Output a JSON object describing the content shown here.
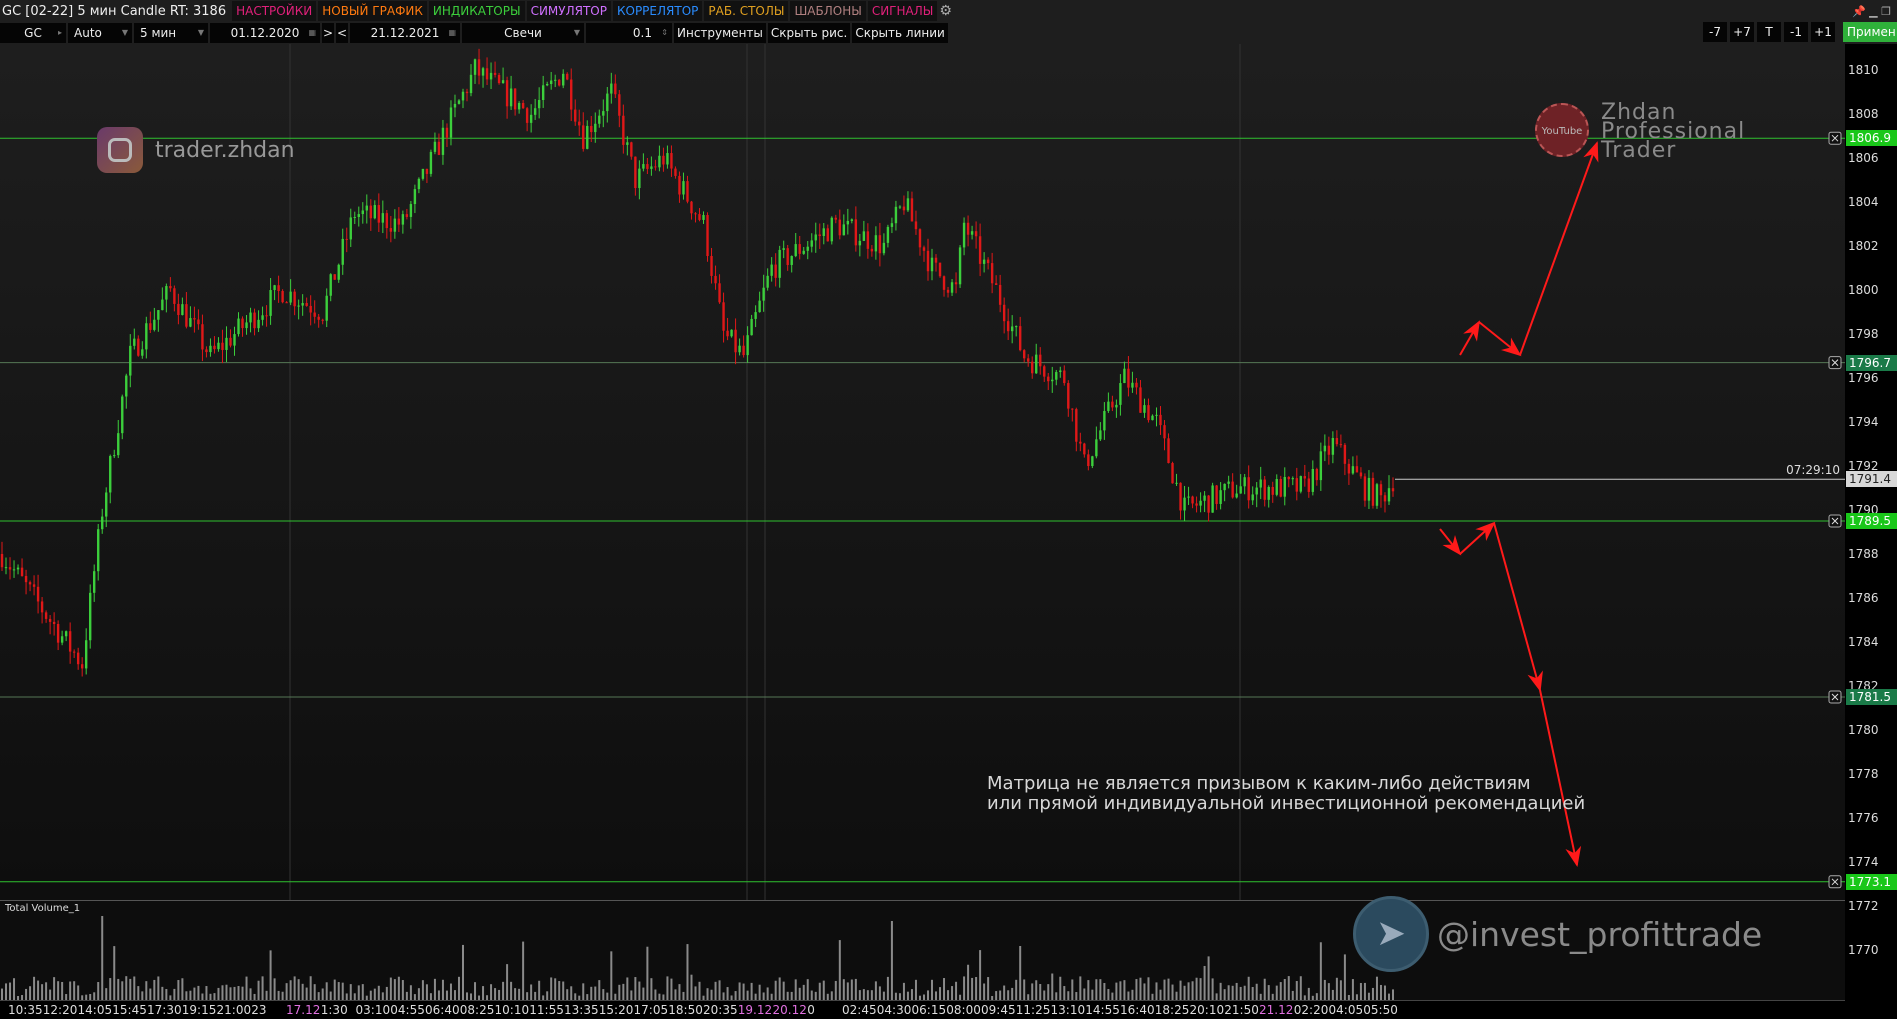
{
  "header": {
    "title": "GC [02-22] 5 мин Candle RT: 3186",
    "menu": [
      {
        "label": "НАСТРОЙКИ",
        "color": "#e0207a"
      },
      {
        "label": "НОВЫЙ ГРАФИК",
        "color": "#ff7a10"
      },
      {
        "label": "ИНДИКАТОРЫ",
        "color": "#3ccf3c"
      },
      {
        "label": "СИМУЛЯТОР",
        "color": "#d070ff"
      },
      {
        "label": "КОРРЕЛЯТОР",
        "color": "#2a8cff"
      },
      {
        "label": "РАБ. СТОЛЫ",
        "color": "#e0a020"
      },
      {
        "label": "ШАБЛОНЫ",
        "color": "#b08080"
      },
      {
        "label": "СИГНАЛЫ",
        "color": "#e0207a"
      }
    ]
  },
  "toolbar": {
    "symbol": "GC",
    "scale": "Auto",
    "timeframe": "5 мин",
    "date_from": "01.12.2020",
    "next": ">",
    "prev": "<",
    "date_to": "21.12.2021",
    "chart_type": "Свечи",
    "step": "0.1",
    "instruments": "Инструменты",
    "hide_drawings": "Скрыть рис.",
    "hide_lines": "Скрыть линии",
    "nav": [
      "-7",
      "+7",
      "T",
      "-1",
      "+1"
    ],
    "apply": "Примен"
  },
  "price_axis": {
    "ticks": [
      1810,
      1808,
      1806,
      1804,
      1802,
      1800,
      1798,
      1796,
      1794,
      1792,
      1790,
      1788,
      1786,
      1784,
      1782,
      1780,
      1778,
      1776,
      1774,
      1772,
      1770
    ]
  },
  "levels": [
    {
      "price": "1806.9",
      "color": "#19c719"
    },
    {
      "price": "1796.7",
      "color": "#1a7a48"
    },
    {
      "price": "1789.5",
      "color": "#19c719"
    },
    {
      "price": "1781.5",
      "color": "#1a7a48"
    },
    {
      "price": "1773.1",
      "color": "#19c719"
    }
  ],
  "current": {
    "price": "1791.4",
    "timer": "07:29:10"
  },
  "volume_label": "Total Volume_1",
  "time_axis": [
    {
      "t": "10:35"
    },
    {
      "t": "12:20"
    },
    {
      "t": "14:05"
    },
    {
      "t": "15:45"
    },
    {
      "t": "17:30"
    },
    {
      "t": "19:15"
    },
    {
      "t": "21:00"
    },
    {
      "t": "23"
    },
    {
      "t": "17.12",
      "d": 1
    },
    {
      "t": "1:30"
    },
    {
      "t": "03:10"
    },
    {
      "t": "04:55"
    },
    {
      "t": "06:40"
    },
    {
      "t": "08:25"
    },
    {
      "t": "10:10"
    },
    {
      "t": "11:55"
    },
    {
      "t": "13:35"
    },
    {
      "t": "15:20"
    },
    {
      "t": "17:05"
    },
    {
      "t": "18:50"
    },
    {
      "t": "20:35"
    },
    {
      "t": "19.12",
      "d": 1
    },
    {
      "t": "20.12",
      "d": 1
    },
    {
      "t": "0"
    },
    {
      "t": "02:45"
    },
    {
      "t": "04:30"
    },
    {
      "t": "06:15"
    },
    {
      "t": "08:00"
    },
    {
      "t": "09:45"
    },
    {
      "t": "11:25"
    },
    {
      "t": "13:10"
    },
    {
      "t": "14:55"
    },
    {
      "t": "16:40"
    },
    {
      "t": "18:25"
    },
    {
      "t": "20:10"
    },
    {
      "t": "21:50"
    },
    {
      "t": "21.12",
      "d": 1
    },
    {
      "t": "02:20"
    },
    {
      "t": "04:05"
    },
    {
      "t": "05:50"
    }
  ],
  "watermarks": {
    "instagram": "trader.zhdan",
    "youtube": [
      "Zhdan",
      "Professional",
      "Trader"
    ],
    "youtube_logo": "YouTube",
    "telegram": "@invest_profittrade"
  },
  "disclaimer": [
    "Матрица не является призывом к каким-либо действиям",
    "или прямой индивидуальной инвестиционной рекомендацией"
  ],
  "chart_data": {
    "type": "candlestick",
    "ylim": [
      1768.5,
      1811
    ],
    "bars": 348,
    "path": [
      [
        0,
        1788
      ],
      [
        20,
        1783
      ],
      [
        25,
        1790
      ],
      [
        32,
        1797
      ],
      [
        42,
        1800
      ],
      [
        52,
        1797
      ],
      [
        70,
        1800
      ],
      [
        80,
        1799
      ],
      [
        88,
        1803.5
      ],
      [
        100,
        1803
      ],
      [
        110,
        1807
      ],
      [
        118,
        1810
      ],
      [
        132,
        1808
      ],
      [
        140,
        1810
      ],
      [
        145,
        1807
      ],
      [
        152,
        1809
      ],
      [
        158,
        1805
      ],
      [
        165,
        1806
      ],
      [
        175,
        1803
      ],
      [
        180,
        1798
      ],
      [
        185,
        1797
      ],
      [
        192,
        1801
      ],
      [
        208,
        1803
      ],
      [
        220,
        1802
      ],
      [
        225,
        1804
      ],
      [
        232,
        1801
      ],
      [
        238,
        1800
      ],
      [
        240,
        1803
      ],
      [
        248,
        1800
      ],
      [
        255,
        1797
      ],
      [
        265,
        1796
      ],
      [
        270,
        1792
      ],
      [
        280,
        1796
      ],
      [
        288,
        1794
      ],
      [
        295,
        1790
      ],
      [
        308,
        1791
      ],
      [
        325,
        1791
      ],
      [
        332,
        1793
      ],
      [
        340,
        1791
      ],
      [
        344,
        1790.5
      ],
      [
        347,
        1791.4
      ]
    ]
  }
}
